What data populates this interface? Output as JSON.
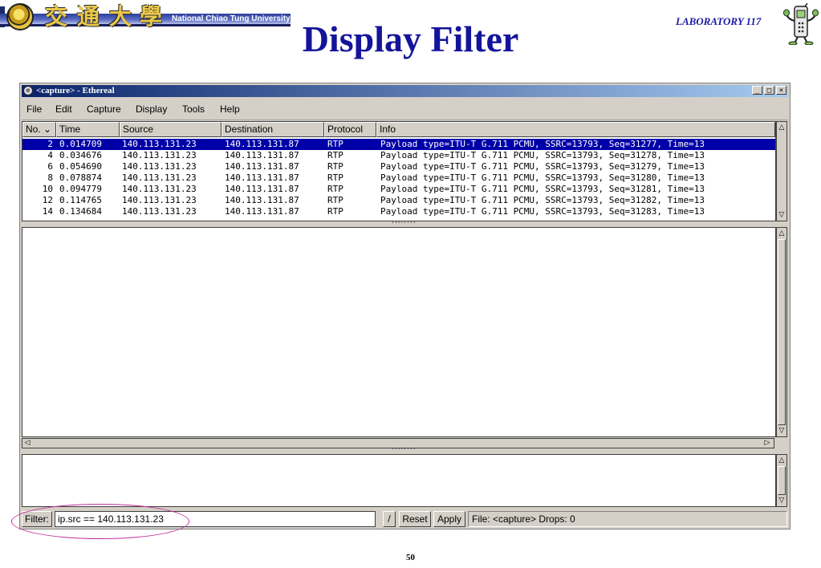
{
  "slide": {
    "title": "Display Filter",
    "lab_label": "LABORATORY 117",
    "banner_text": "National Chiao Tung University",
    "banner_cjk": [
      "交",
      "通",
      "大",
      "學"
    ],
    "page_number": "50"
  },
  "window": {
    "title": "<capture> - Ethereal",
    "controls": {
      "minimize": "_",
      "maximize": "□",
      "close": "×"
    }
  },
  "menu": {
    "file": "File",
    "edit": "Edit",
    "capture": "Capture",
    "display": "Display",
    "tools": "Tools",
    "help": "Help"
  },
  "packet_list": {
    "columns": [
      "No. ⌄",
      "Time",
      "Source",
      "Destination",
      "Protocol",
      "Info"
    ],
    "rows": [
      {
        "no": "2",
        "time": "0.014709",
        "source": "140.113.131.23",
        "destination": "140.113.131.87",
        "protocol": "RTP",
        "info": "Payload type=ITU-T G.711 PCMU, SSRC=13793, Seq=31277, Time=13",
        "selected": true
      },
      {
        "no": "4",
        "time": "0.034676",
        "source": "140.113.131.23",
        "destination": "140.113.131.87",
        "protocol": "RTP",
        "info": "Payload type=ITU-T G.711 PCMU, SSRC=13793, Seq=31278, Time=13",
        "selected": false
      },
      {
        "no": "6",
        "time": "0.054690",
        "source": "140.113.131.23",
        "destination": "140.113.131.87",
        "protocol": "RTP",
        "info": "Payload type=ITU-T G.711 PCMU, SSRC=13793, Seq=31279, Time=13",
        "selected": false
      },
      {
        "no": "8",
        "time": "0.078874",
        "source": "140.113.131.23",
        "destination": "140.113.131.87",
        "protocol": "RTP",
        "info": "Payload type=ITU-T G.711 PCMU, SSRC=13793, Seq=31280, Time=13",
        "selected": false
      },
      {
        "no": "10",
        "time": "0.094779",
        "source": "140.113.131.23",
        "destination": "140.113.131.87",
        "protocol": "RTP",
        "info": "Payload type=ITU-T G.711 PCMU, SSRC=13793, Seq=31281, Time=13",
        "selected": false
      },
      {
        "no": "12",
        "time": "0.114765",
        "source": "140.113.131.23",
        "destination": "140.113.131.87",
        "protocol": "RTP",
        "info": "Payload type=ITU-T G.711 PCMU, SSRC=13793, Seq=31282, Time=13",
        "selected": false
      },
      {
        "no": "14",
        "time": "0.134684",
        "source": "140.113.131.23",
        "destination": "140.113.131.87",
        "protocol": "RTP",
        "info": "Payload type=ITU-T G.711 PCMU, SSRC=13793, Seq=31283, Time=13",
        "selected": false
      }
    ]
  },
  "statusbar": {
    "filter_label": "Filter:",
    "filter_value": "ip.src == 140.113.131.23",
    "combo_arrow": "/",
    "reset_label": "Reset",
    "apply_label": "Apply",
    "status_text": "File: <capture>  Drops: 0"
  },
  "colors": {
    "title_blue": "#14149a",
    "selection": "#0000a8",
    "highlight_ellipse": "#c02d9a",
    "window_face": "#d4d0c8"
  }
}
